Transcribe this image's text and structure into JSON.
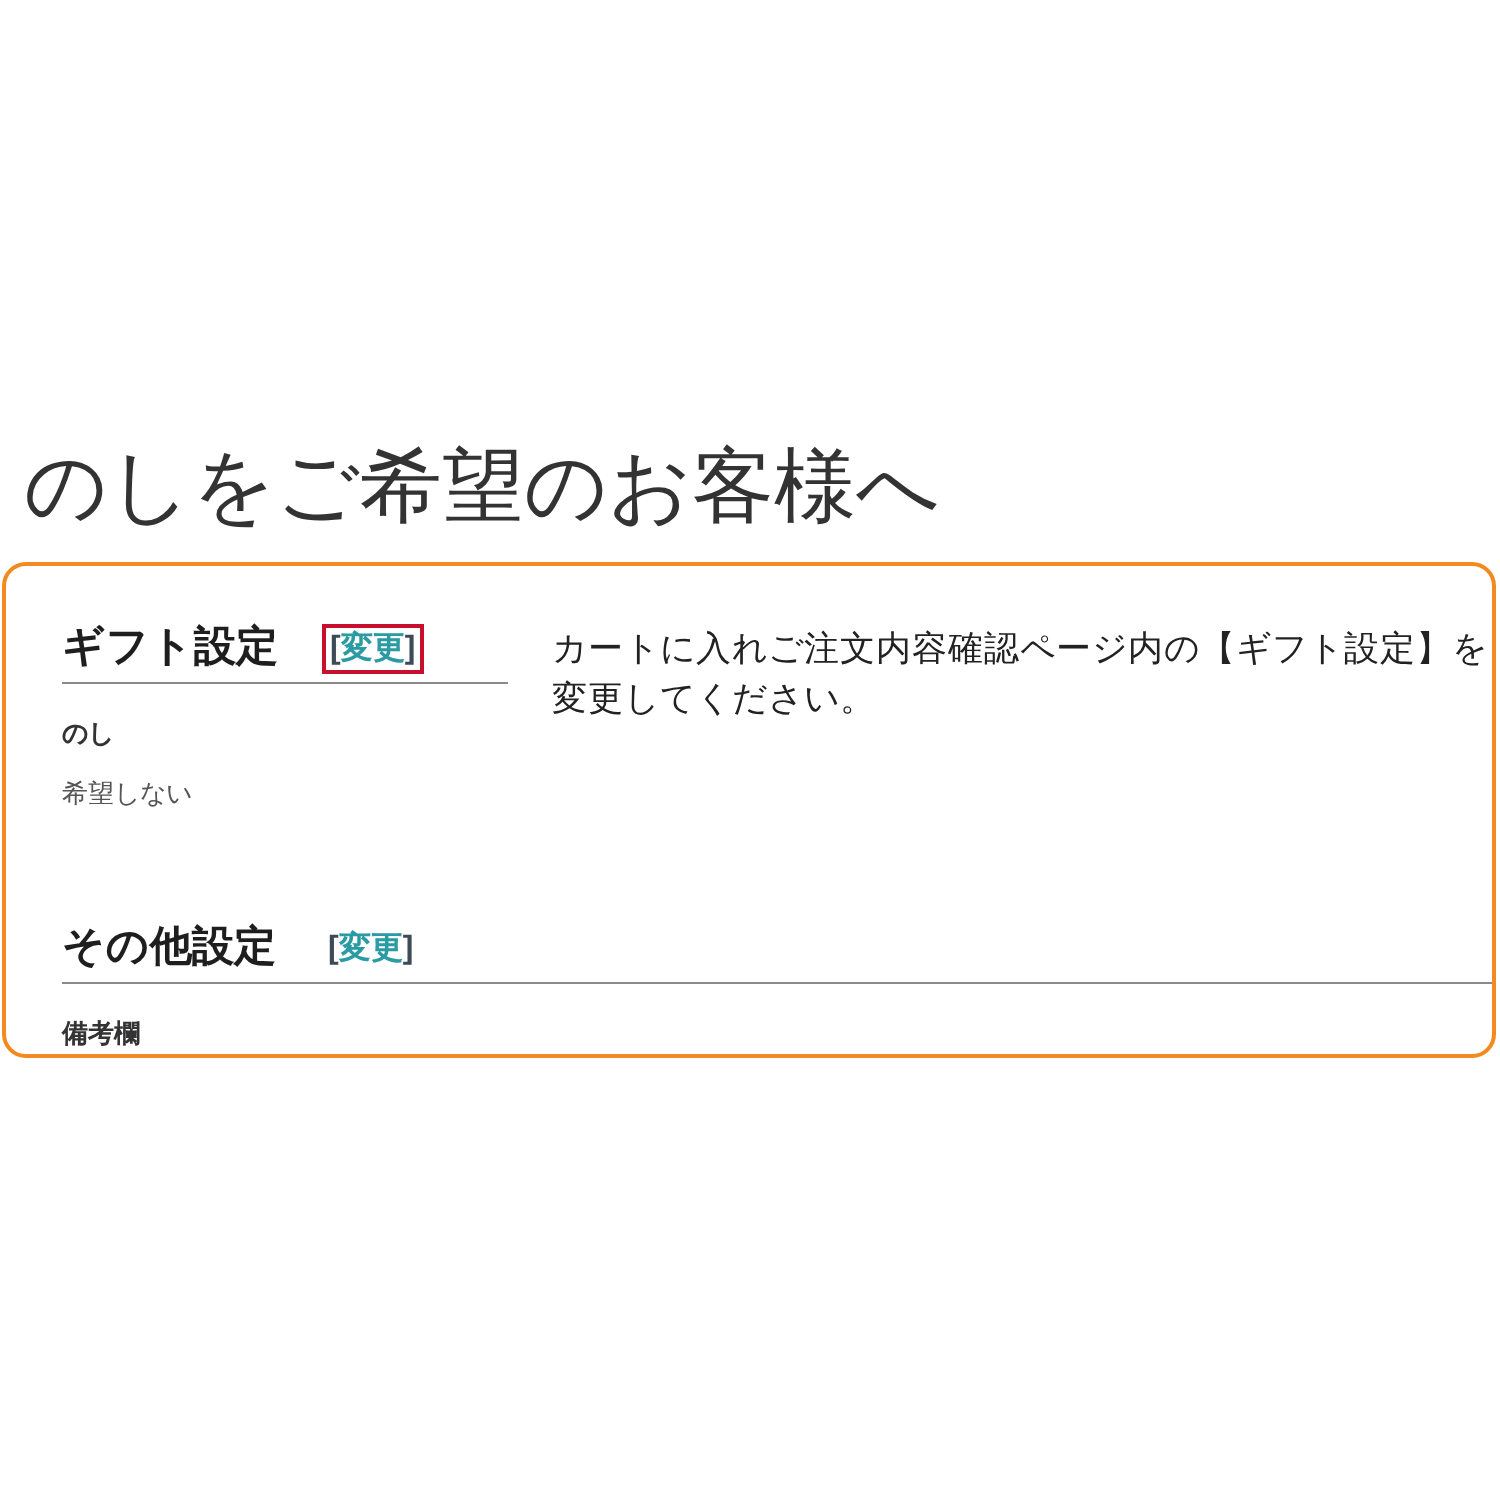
{
  "title": "のしをご希望のお客様へ",
  "sections": [
    {
      "heading": "ギフト設定",
      "change_link": {
        "text": "[変更]",
        "highlighted": true
      },
      "fields": [
        {
          "label": "のし",
          "value": "希望しない"
        }
      ],
      "note": "カートに入れご注文内容確認ページ内の【ギフト設定】を変更してください。"
    },
    {
      "heading": "その他設定",
      "change_link": {
        "text": "[変更]",
        "highlighted": false
      },
      "fields": [
        {
          "label": "備考欄"
        }
      ]
    }
  ]
}
